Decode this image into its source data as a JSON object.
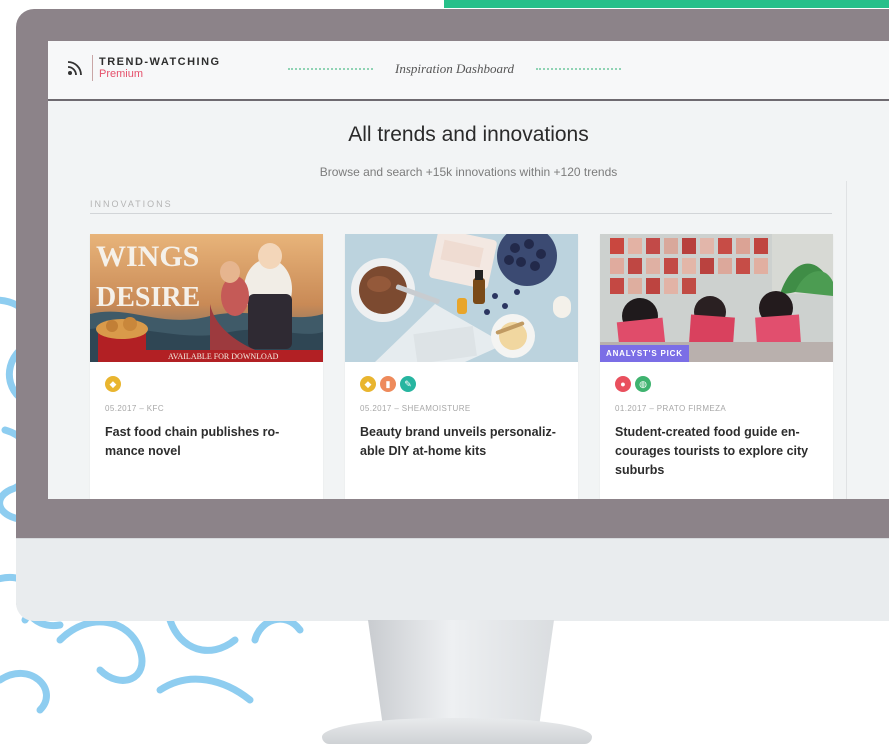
{
  "brand": {
    "name": "TREND-WATCHING",
    "tier": "Premium"
  },
  "header": {
    "title": "Inspiration Dashboard"
  },
  "page": {
    "title": "All trends and innovations",
    "subtitle": "Browse and search +15k innovations within +120 trends"
  },
  "section": {
    "label": "INNOVATIONS"
  },
  "cards": [
    {
      "date_brand": "05.2017 – KFC",
      "title": "Fast food chain publishes ro-mance novel",
      "image_text_1": "WINGS",
      "image_text_2": "DESIRE",
      "image_text_3": "AVAILABLE FOR DOWNLOAD",
      "icons": [
        {
          "name": "diamond-icon",
          "color": "#e9b52f"
        }
      ]
    },
    {
      "date_brand": "05.2017 – SHEAMOISTURE",
      "title": "Beauty brand unveils personaliz-able DIY at-home kits",
      "icons": [
        {
          "name": "diamond-icon",
          "color": "#e9b52f"
        },
        {
          "name": "bottle-icon",
          "color": "#ee8a5b"
        },
        {
          "name": "leaf-icon",
          "color": "#27b5a0"
        }
      ]
    },
    {
      "date_brand": "01.2017 – PRATO FIRMEZA",
      "title": "Student-created food guide en-courages tourists to explore city suburbs",
      "badge": "ANALYST'S PICK",
      "icons": [
        {
          "name": "lightbulb-icon",
          "color": "#e9505e"
        },
        {
          "name": "globe-icon",
          "color": "#3fb36f"
        }
      ]
    }
  ],
  "colors": {
    "accent_green": "#27c08a",
    "premium_red": "#e5506b",
    "squiggle_blue": "#8ecdf0",
    "monitor_bezel": "#8c8389"
  }
}
